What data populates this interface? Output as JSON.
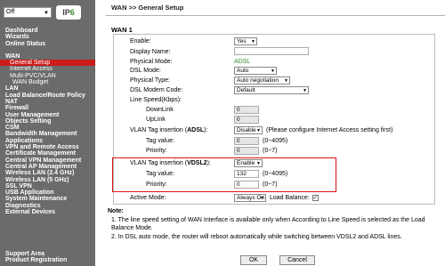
{
  "sidebar": {
    "mode_select": "Off",
    "logo": {
      "prefix": "IP",
      "suffix": "6"
    },
    "menu": [
      {
        "label": "Dashboard",
        "level": 0
      },
      {
        "label": "Wizards",
        "level": 0
      },
      {
        "label": "Online Status",
        "level": 0
      },
      {
        "label": "",
        "level": 0
      },
      {
        "label": "WAN",
        "level": 0
      },
      {
        "label": "General Setup",
        "level": 1,
        "active": true
      },
      {
        "label": "Internet Access",
        "level": 1
      },
      {
        "label": "Multi-PVC/VLAN",
        "level": 1
      },
      {
        "label": "WAN Budget",
        "level": 2
      },
      {
        "label": "LAN",
        "level": 0
      },
      {
        "label": "Load Balance/Route Policy",
        "level": 0
      },
      {
        "label": "NAT",
        "level": 0
      },
      {
        "label": "Firewall",
        "level": 0
      },
      {
        "label": "User Management",
        "level": 0
      },
      {
        "label": "Objects Setting",
        "level": 0
      },
      {
        "label": "CSM",
        "level": 0
      },
      {
        "label": "Bandwidth Management",
        "level": 0
      },
      {
        "label": "Applications",
        "level": 0
      },
      {
        "label": "VPN and Remote Access",
        "level": 0
      },
      {
        "label": "Certificate Management",
        "level": 0
      },
      {
        "label": "Central VPN Management",
        "level": 0
      },
      {
        "label": "Central AP Management",
        "level": 0
      },
      {
        "label": "Wireless LAN (2.4 GHz)",
        "level": 0
      },
      {
        "label": "Wireless LAN (5 GHz)",
        "level": 0
      },
      {
        "label": "SSL VPN",
        "level": 0
      },
      {
        "label": "USB Application",
        "level": 0
      },
      {
        "label": "System Maintenance",
        "level": 0
      },
      {
        "label": "Diagnostics",
        "level": 0
      },
      {
        "label": "External Devices",
        "level": 0
      }
    ],
    "bottom": [
      "Support Area",
      "Product Registration"
    ]
  },
  "main": {
    "breadcrumb": "WAN >> General Setup",
    "section_title": "WAN 1",
    "fields": {
      "enable": {
        "label": "Enable:",
        "value": "Yes"
      },
      "display_name": {
        "label": "Display Name:",
        "value": ""
      },
      "physical_mode": {
        "label": "Physical Mode:",
        "value": "ADSL"
      },
      "dsl_mode": {
        "label": "DSL Mode:",
        "value": "Auto"
      },
      "physical_type": {
        "label": "Physical Type:",
        "value": "Auto negotiation"
      },
      "dsl_modem_code": {
        "label": "DSL Modem Code:",
        "value": "Default"
      },
      "line_speed": {
        "label": "Line Speed(Kbps):"
      },
      "downlink": {
        "label": "DownLink",
        "value": "0"
      },
      "uplink": {
        "label": "UpLink",
        "value": "0"
      },
      "vlan_adsl": {
        "label_pre": "VLAN Tag insertion (",
        "label_bold": "ADSL",
        "label_post": "):",
        "value": "Disable",
        "hint": "(Please configure Internet Access setting first)"
      },
      "tag_value_adsl": {
        "label": "Tag value:",
        "value": "0",
        "hint": "(0~4095)"
      },
      "priority_adsl": {
        "label": "Priority:",
        "value": "0",
        "hint": "(0~7)"
      },
      "vlan_vdsl2": {
        "label_pre": "VLAN Tag insertion (",
        "label_bold": "VDSL2",
        "label_post": "):",
        "value": "Enable"
      },
      "tag_value_vdsl2": {
        "label": "Tag value:",
        "value": "132",
        "hint": "(0~4095)"
      },
      "priority_vdsl2": {
        "label": "Priority:",
        "value": "0",
        "hint": "(0~7)"
      },
      "active_mode": {
        "label": "Active Mode:",
        "value": "Always On"
      },
      "load_balance": {
        "label": "Load Balance:",
        "checked": true
      }
    },
    "note": {
      "title": "Note:",
      "lines": [
        "1. The line speed setting of WAN Interface is available only when According to Line Speed is selected as the Load Balance Mode.",
        "2. In DSL auto mode, the router will reboot automatically while switching between VDSL2 and ADSL lines."
      ]
    },
    "buttons": {
      "ok": "OK",
      "cancel": "Cancel"
    }
  },
  "colors": {
    "sidebar_bg": "#6b6b6b",
    "active_item": "#cc1c1c",
    "highlight_box": "#dd1111",
    "physical_mode_text": "#2a8a2a"
  }
}
